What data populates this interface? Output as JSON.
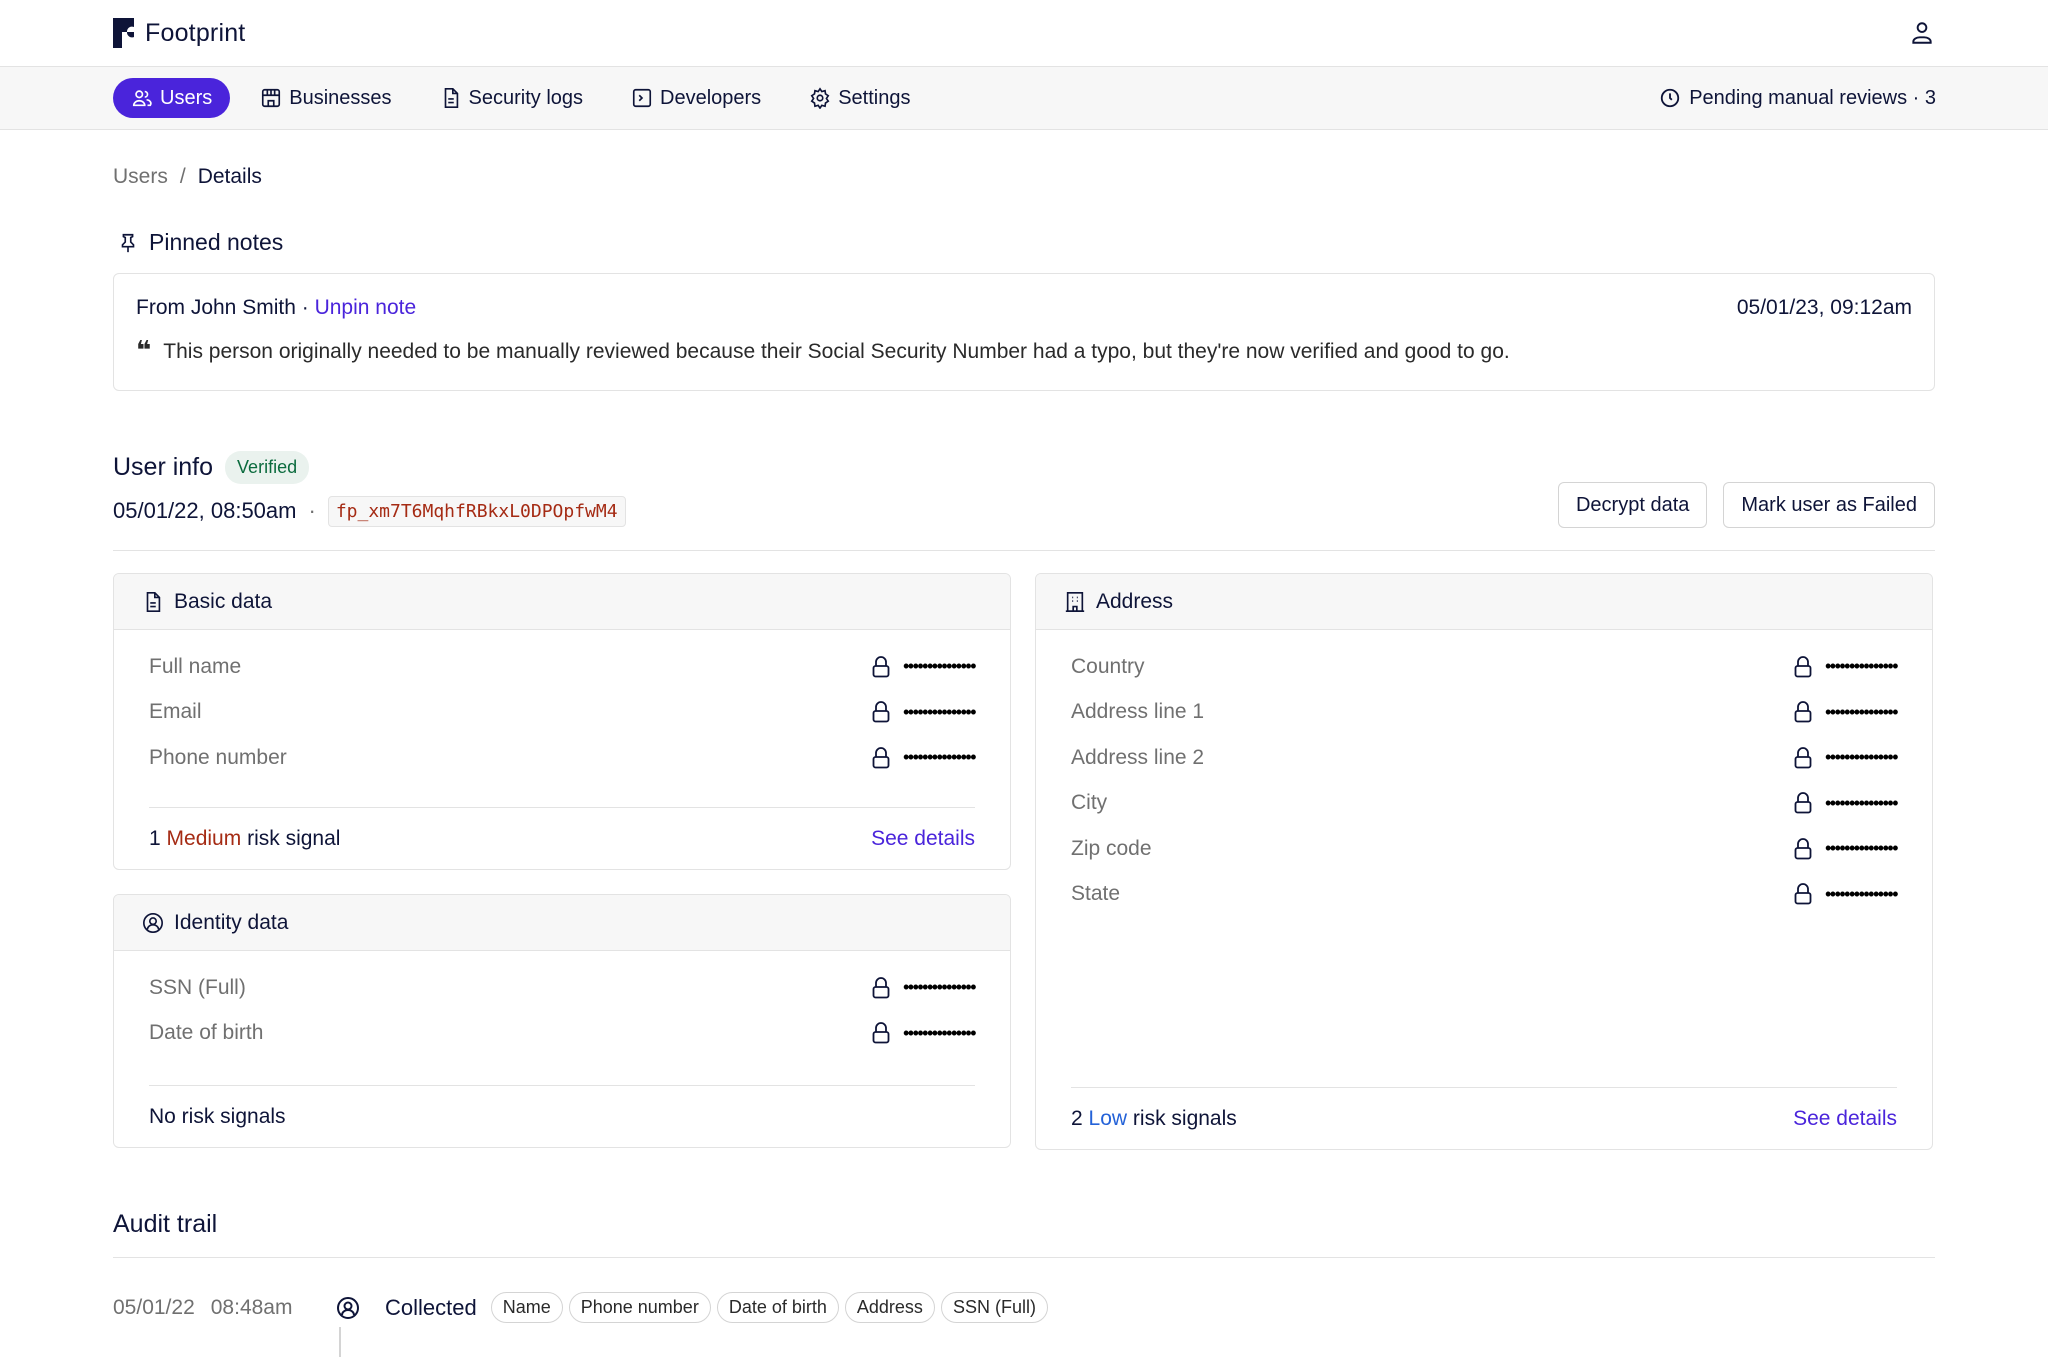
{
  "app": {
    "brand": "Footprint"
  },
  "nav": {
    "items": [
      {
        "label": "Users",
        "icon": "users-icon",
        "active": true
      },
      {
        "label": "Businesses",
        "icon": "store-icon",
        "active": false
      },
      {
        "label": "Security logs",
        "icon": "file-text-icon",
        "active": false
      },
      {
        "label": "Developers",
        "icon": "terminal-icon",
        "active": false
      },
      {
        "label": "Settings",
        "icon": "gear-icon",
        "active": false
      }
    ],
    "pending_reviews_label": "Pending manual reviews · 3"
  },
  "breadcrumb": {
    "parent": "Users",
    "separator": "/",
    "current": "Details"
  },
  "pinned_notes": {
    "title": "Pinned notes",
    "note": {
      "author": "From John Smith",
      "separator": " · ",
      "unpin_label": "Unpin note",
      "timestamp": "05/01/23, 09:12am",
      "text": "This person originally needed to be manually reviewed because their Social Security Number had a typo, but they're now verified and good to go."
    }
  },
  "user_info": {
    "title": "User info",
    "status_badge": "Verified",
    "created_at": "05/01/22, 08:50am",
    "separator": "·",
    "user_id": "fp_xm7T6MqhfRBkxL0DPOpfwM4",
    "actions": {
      "decrypt": "Decrypt data",
      "mark_failed": "Mark user as Failed"
    }
  },
  "cards": {
    "basic": {
      "title": "Basic data",
      "fields": [
        {
          "label": "Full name",
          "value": "•••••••••••••••"
        },
        {
          "label": "Email",
          "value": "•••••••••••••••"
        },
        {
          "label": "Phone number",
          "value": "•••••••••••••••"
        }
      ],
      "risk": {
        "count": "1",
        "level": "Medium",
        "suffix": "risk signal",
        "link": "See details"
      }
    },
    "identity": {
      "title": "Identity data",
      "fields": [
        {
          "label": "SSN (Full)",
          "value": "•••••••••••••••"
        },
        {
          "label": "Date of birth",
          "value": "•••••••••••••••"
        }
      ],
      "risk": {
        "text": "No risk signals"
      }
    },
    "address": {
      "title": "Address",
      "fields": [
        {
          "label": "Country",
          "value": "•••••••••••••••"
        },
        {
          "label": "Address line 1",
          "value": "•••••••••••••••"
        },
        {
          "label": "Address line 2",
          "value": "•••••••••••••••"
        },
        {
          "label": "City",
          "value": "•••••••••••••••"
        },
        {
          "label": "Zip code",
          "value": "•••••••••••••••"
        },
        {
          "label": "State",
          "value": "•••••••••••••••"
        }
      ],
      "risk": {
        "count": "2",
        "level": "Low",
        "suffix": "risk signals",
        "link": "See details"
      }
    }
  },
  "audit_trail": {
    "title": "Audit trail",
    "events": [
      {
        "date": "05/01/22",
        "time": "08:48am",
        "event": "Collected",
        "tags": [
          "Name",
          "Phone number",
          "Date of birth",
          "Address",
          "SSN (Full)"
        ]
      }
    ]
  },
  "colors": {
    "accent": "#4a24db",
    "risk_medium": "#a52b14",
    "risk_low": "#2462d8",
    "verified": "#0b6b3e"
  }
}
